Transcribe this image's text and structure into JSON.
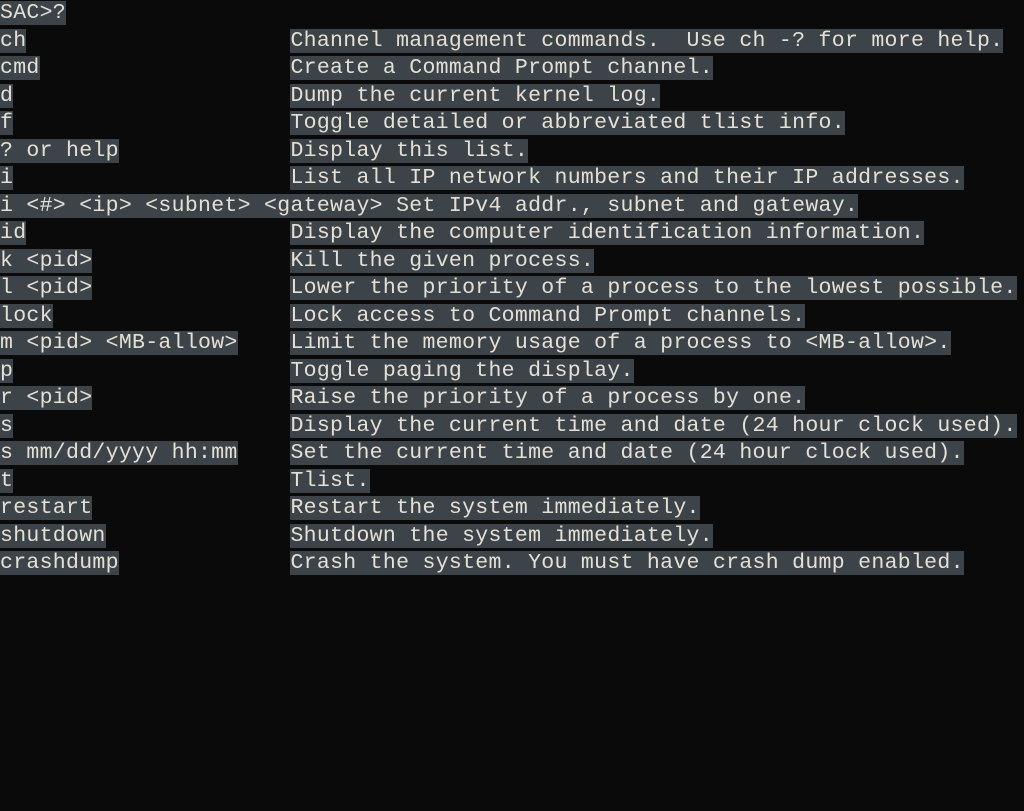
{
  "prompt": "SAC>?",
  "commands": [
    {
      "cmd": "ch",
      "desc": "Channel management commands.  Use ch -? for more help."
    },
    {
      "cmd": "cmd",
      "desc": "Create a Command Prompt channel."
    },
    {
      "cmd": "d",
      "desc": "Dump the current kernel log."
    },
    {
      "cmd": "f",
      "desc": "Toggle detailed or abbreviated tlist info."
    },
    {
      "cmd": "? or help",
      "desc": "Display this list."
    },
    {
      "cmd": "i",
      "desc": "List all IP network numbers and their IP addresses."
    },
    {
      "cmd": "i <#> <ip> <subnet> <gateway>",
      "desc": "Set IPv4 addr., subnet and gateway.",
      "inline": true
    },
    {
      "cmd": "id",
      "desc": "Display the computer identification information."
    },
    {
      "cmd": "k <pid>",
      "desc": "Kill the given process."
    },
    {
      "cmd": "l <pid>",
      "desc": "Lower the priority of a process to the lowest possible."
    },
    {
      "cmd": "lock",
      "desc": "Lock access to Command Prompt channels."
    },
    {
      "cmd": "m <pid> <MB-allow>",
      "desc": "Limit the memory usage of a process to <MB-allow>."
    },
    {
      "cmd": "p",
      "desc": "Toggle paging the display."
    },
    {
      "cmd": "r <pid>",
      "desc": "Raise the priority of a process by one."
    },
    {
      "cmd": "s",
      "desc": "Display the current time and date (24 hour clock used)."
    },
    {
      "cmd": "s mm/dd/yyyy hh:mm",
      "desc": "Set the current time and date (24 hour clock used)."
    },
    {
      "cmd": "t",
      "desc": "Tlist."
    },
    {
      "cmd": "restart",
      "desc": "Restart the system immediately."
    },
    {
      "cmd": "shutdown",
      "desc": "Shutdown the system immediately."
    },
    {
      "cmd": "crashdump",
      "desc": "Crash the system. You must have crash dump enabled."
    }
  ]
}
